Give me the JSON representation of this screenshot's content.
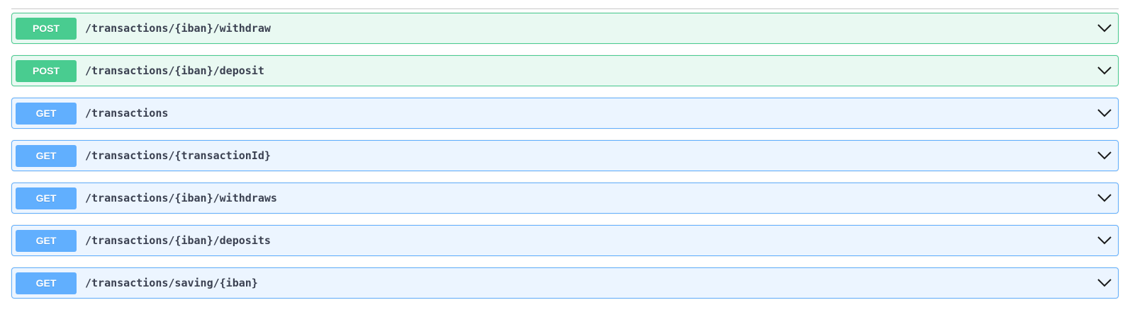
{
  "operations": [
    {
      "method": "POST",
      "path": "/transactions/{iban}/withdraw"
    },
    {
      "method": "POST",
      "path": "/transactions/{iban}/deposit"
    },
    {
      "method": "GET",
      "path": "/transactions"
    },
    {
      "method": "GET",
      "path": "/transactions/{transactionId}"
    },
    {
      "method": "GET",
      "path": "/transactions/{iban}/withdraws"
    },
    {
      "method": "GET",
      "path": "/transactions/{iban}/deposits"
    },
    {
      "method": "GET",
      "path": "/transactions/saving/{iban}"
    }
  ],
  "colors": {
    "post": "#49cc90",
    "get": "#61affe",
    "text": "#3b4151"
  },
  "icons": {
    "expand": "chevron-down-icon"
  }
}
